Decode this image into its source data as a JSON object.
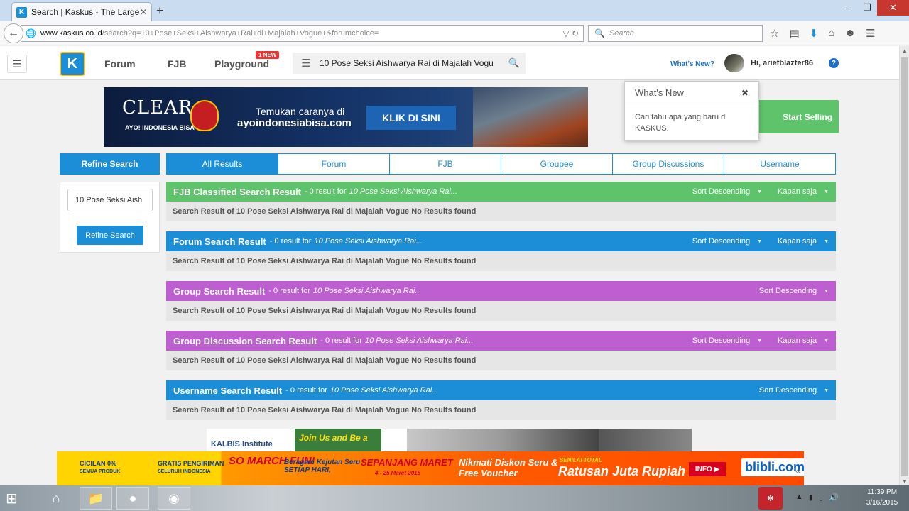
{
  "browser": {
    "tab_title": "Search | Kaskus - The Large...",
    "tab_icon": "K",
    "new_tab": "+",
    "url_host": "www.kaskus.co.id",
    "url_path": "/search?q=10+Pose+Seksi+Aishwarya+Rai+di+Majalah+Vogue+&forumchoice=",
    "search_placeholder": "Search"
  },
  "header": {
    "logo": "K",
    "nav": [
      "Forum",
      "FJB",
      "Playground"
    ],
    "new_badge": "1 NEW",
    "search_value": "10 Pose Seksi Aishwarya Rai di Majalah Vogu",
    "whats_new_link": "What's New?",
    "greeting": "Hi, ariefblazter86",
    "help": "?"
  },
  "banner": {
    "brand": "CLEAR",
    "tagline": "AYO! INDONESIA BISA",
    "line1": "Temukan caranya di",
    "line2": "ayoindonesiabisa.com",
    "cta": "KLIK DI SINI"
  },
  "start_selling": "Start Selling",
  "popup": {
    "title": "What's New",
    "close": "✖",
    "body": "Cari tahu apa yang baru di KASKUS."
  },
  "refine": {
    "title": "Refine Search",
    "input_value": "10 Pose Seksi Aish",
    "button": "Refine Search"
  },
  "tabs": [
    "All Results",
    "Forum",
    "FJB",
    "Groupee",
    "Group Discussions",
    "Username"
  ],
  "sections": [
    {
      "title": "FJB Classified Search Result",
      "count": "- 0 result for",
      "term": "10 Pose Seksi Aishwarya Rai...",
      "sort": "Sort Descending",
      "time": "Kapan saja",
      "message": "Search Result of 10 Pose Seksi Aishwarya Rai di Majalah Vogue No Results found",
      "color": "#5ec36b"
    },
    {
      "title": "Forum Search Result",
      "count": "- 0 result for",
      "term": "10 Pose Seksi Aishwarya Rai...",
      "sort": "Sort Descending",
      "time": "Kapan saja",
      "message": "Search Result of 10 Pose Seksi Aishwarya Rai di Majalah Vogue No Results found",
      "color": "#1c8ed8"
    },
    {
      "title": "Group Search Result",
      "count": "- 0 result for",
      "term": "10 Pose Seksi Aishwarya Rai...",
      "sort": "Sort Descending",
      "message": "Search Result of 10 Pose Seksi Aishwarya Rai di Majalah Vogue No Results found",
      "color": "#bd5ed1"
    },
    {
      "title": "Group Discussion Search Result",
      "count": "- 0 result for",
      "term": "10 Pose Seksi Aishwarya Rai...",
      "sort": "Sort Descending",
      "time": "Kapan saja",
      "message": "Search Result of 10 Pose Seksi Aishwarya Rai di Majalah Vogue No Results found",
      "color": "#bd5ed1"
    },
    {
      "title": "Username Search Result",
      "count": "- 0 result for",
      "term": "10 Pose Seksi Aishwarya Rai...",
      "sort": "Sort Descending",
      "message": "Search Result of 10 Pose Seksi Aishwarya Rai di Majalah Vogue No Results found",
      "color": "#1c8ed8"
    }
  ],
  "ads": {
    "kalbis": "KALBIS Institute",
    "join": "Join Us and Be a",
    "cicilan": "CICILAN 0%",
    "cicilan_sub": "SEMUA PRODUK",
    "gratis": "GRATIS PENGIRIMAN",
    "gratis_sub": "SELURUH INDONESIA",
    "fun": "SO MARCH FUN!",
    "beragam": "Beragam Kejutan Seru SETIAP HARI,",
    "sepanjang": "SEPANJANG MARET",
    "tanggal": "4 - 25 Maret 2015",
    "diskon": "Nikmati Diskon Seru & Free Voucher",
    "senilai": "SENILAI TOTAL",
    "ratusan": "Ratusan Juta Rupiah",
    "info": "INFO ▶",
    "brand": "blibli.com"
  },
  "taskbar": {
    "time": "11:39 PM",
    "date": "3/16/2015"
  }
}
